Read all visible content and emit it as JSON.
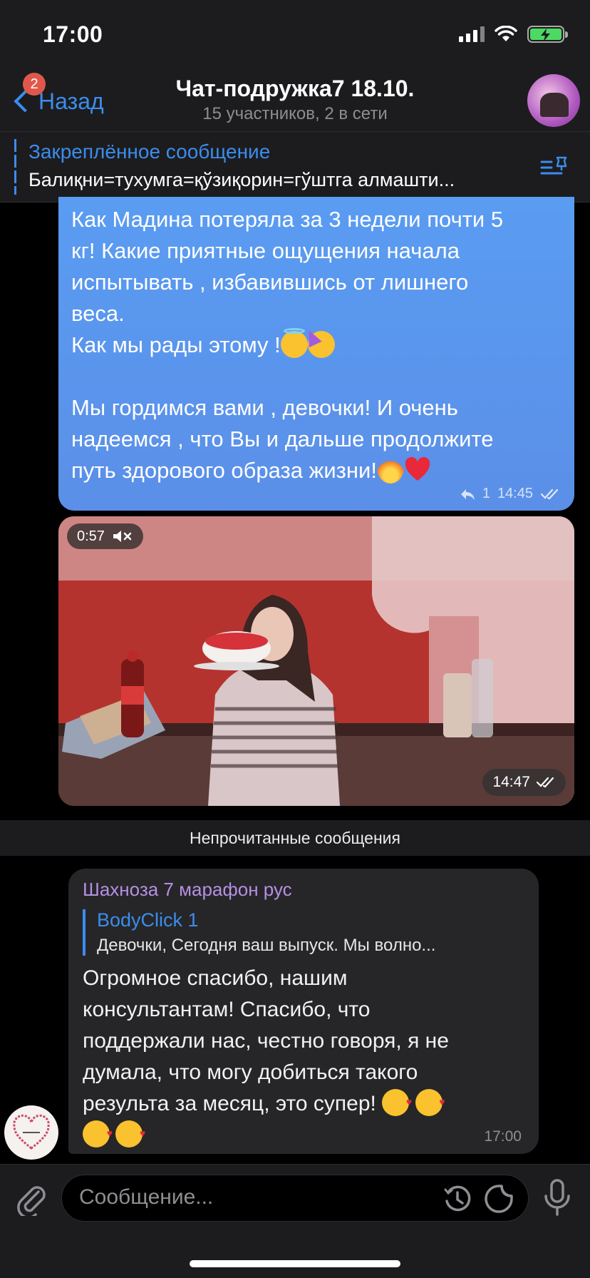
{
  "status_bar": {
    "time": "17:00",
    "icons": [
      "signal-icon",
      "wifi-icon",
      "battery-charging-icon"
    ]
  },
  "header": {
    "back_label": "Назад",
    "back_badge": "2",
    "title": "Чат-подружка7 18.10.",
    "subtitle": "15 участников, 2 в сети"
  },
  "pinned": {
    "title": "Закреплённое сообщение",
    "text": "Балиқни=тухумга=қўзиқорин=гўштга алмашти..."
  },
  "outgoing_message": {
    "text_line1": "Как Мадина потеряла за 3 недели почти 5\nкг! Какие приятные ощущения начала\nиспытывать , избавившись от лишнего\nвеса.\nКак мы рады этому !",
    "text_line2": "Мы гордимся вами , девочки! И очень\nнадеемся , что Вы и дальше продолжите\nпуть здорового образа жизни!",
    "replies": "1",
    "time": "14:45"
  },
  "video_message": {
    "duration": "0:57",
    "time": "14:47"
  },
  "unread_divider": "Непрочитанные сообщения",
  "incoming_message": {
    "sender": "Шахноза 7 марафон рус",
    "reply_author": "BodyClick 1",
    "reply_text": "Девочки,  Сегодня ваш выпуск.  Мы волно...",
    "text": "Огромное спасибо, нашим\nконсультантам! Спасибо, что\nподдержали нас, честно говоря, я не\nдумала, что могу добиться такого\nрезульта за месяц, это супер!",
    "time": "17:00"
  },
  "input_bar": {
    "placeholder": "Сообщение..."
  },
  "colors": {
    "accent": "#3b8ded",
    "outgoing_bubble": "#5a9cf2",
    "incoming_bubble": "#262628",
    "sender_name": "#b78fe3",
    "badge": "#e0584b"
  }
}
